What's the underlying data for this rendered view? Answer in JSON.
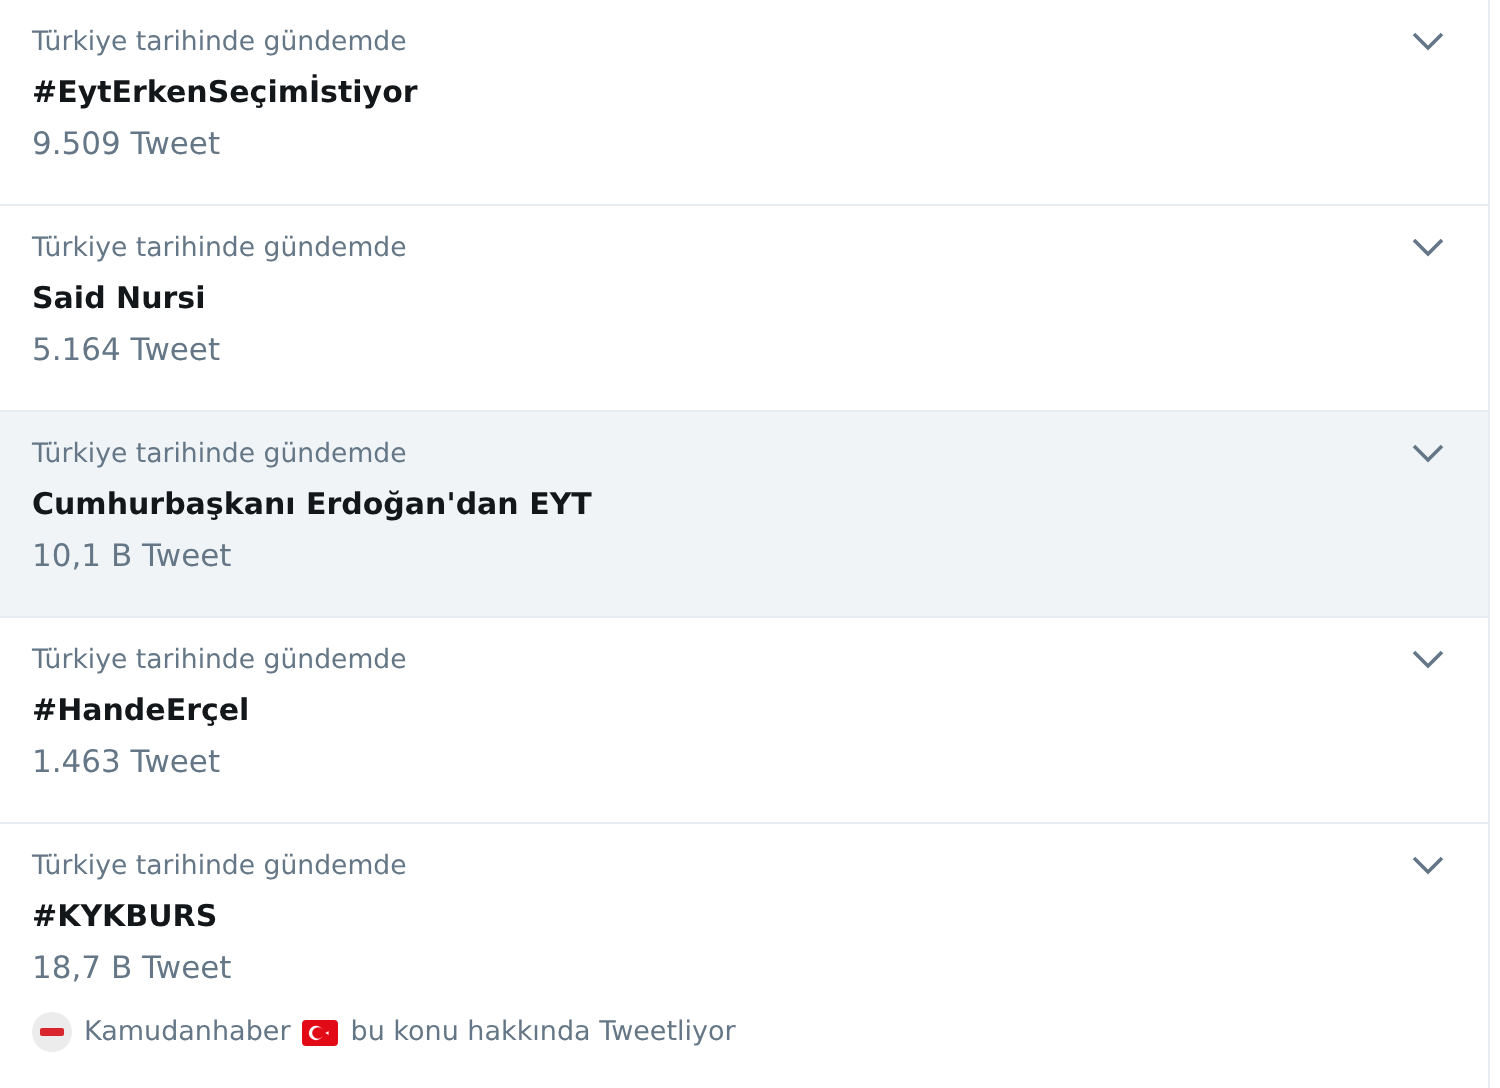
{
  "trends": [
    {
      "context": "Türkiye tarihinde gündemde",
      "title": "#EytErkenSeçimİstiyor",
      "count": "9.509 Tweet",
      "hovered": false
    },
    {
      "context": "Türkiye tarihinde gündemde",
      "title": "Said Nursi",
      "count": "5.164 Tweet",
      "hovered": false
    },
    {
      "context": "Türkiye tarihinde gündemde",
      "title": "Cumhurbaşkanı Erdoğan'dan EYT",
      "count": "10,1 B Tweet",
      "hovered": true
    },
    {
      "context": "Türkiye tarihinde gündemde",
      "title": "#HandeErçel",
      "count": "1.463 Tweet",
      "hovered": false
    },
    {
      "context": "Türkiye tarihinde gündemde",
      "title": "#KYKBURS",
      "count": "18,7 B Tweet",
      "hovered": false,
      "tweeting": {
        "author": "Kamudanhaber",
        "text": "bu konu hakkında Tweetliyor"
      }
    }
  ]
}
